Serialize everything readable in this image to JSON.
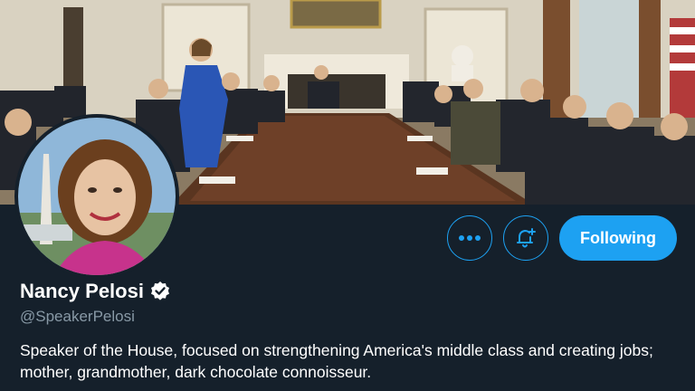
{
  "profile": {
    "display_name": "Nancy Pelosi",
    "handle": "@SpeakerPelosi",
    "bio": "Speaker of the House, focused on strengthening America's middle class and creating jobs; mother, grandmother, dark chocolate connoisseur.",
    "verified": true
  },
  "actions": {
    "more_icon": "more-horizontal-icon",
    "notify_icon": "bell-plus-icon",
    "follow_label": "Following"
  },
  "colors": {
    "background": "#15202b",
    "accent": "#1da1f2",
    "secondary_text": "#8899a6",
    "primary_text": "#ffffff"
  }
}
